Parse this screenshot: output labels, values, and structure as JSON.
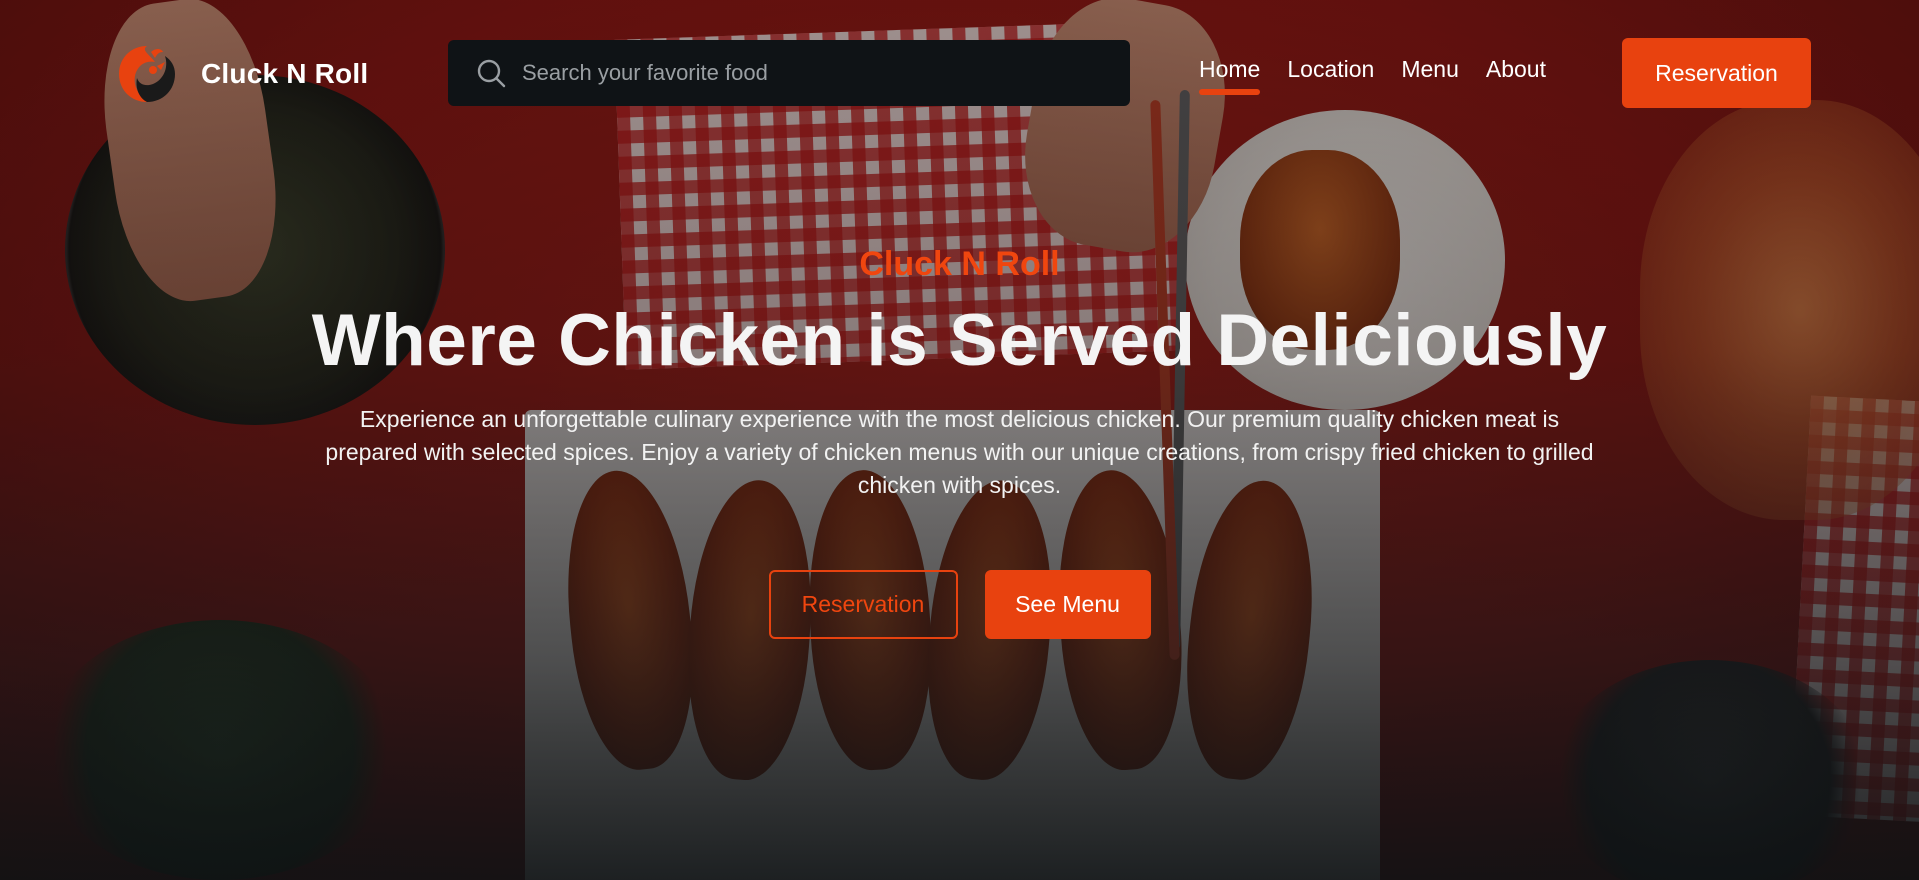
{
  "brand": {
    "name": "Cluck N Roll",
    "logo_icon": "rooster-swirl-icon"
  },
  "search": {
    "placeholder": "Search your favorite food",
    "value": "",
    "icon": "search-icon"
  },
  "nav": {
    "items": [
      {
        "label": "Home",
        "active": true
      },
      {
        "label": "Location",
        "active": false
      },
      {
        "label": "Menu",
        "active": false
      },
      {
        "label": "About",
        "active": false
      }
    ],
    "cta_label": "Reservation"
  },
  "hero": {
    "eyebrow": "Cluck N Roll",
    "headline": "Where Chicken is Served Deliciously",
    "description": "Experience an unforgettable culinary experience with the most delicious chicken. Our premium quality chicken meat is prepared with selected spices. Enjoy a variety of chicken menus with our unique creations, from crispy fried chicken to grilled chicken with spices.",
    "primary_button": "Reservation",
    "secondary_button": "See Menu"
  },
  "colors": {
    "accent": "#e8420f",
    "search_bg": "#0f1316",
    "text": "#ffffff"
  }
}
